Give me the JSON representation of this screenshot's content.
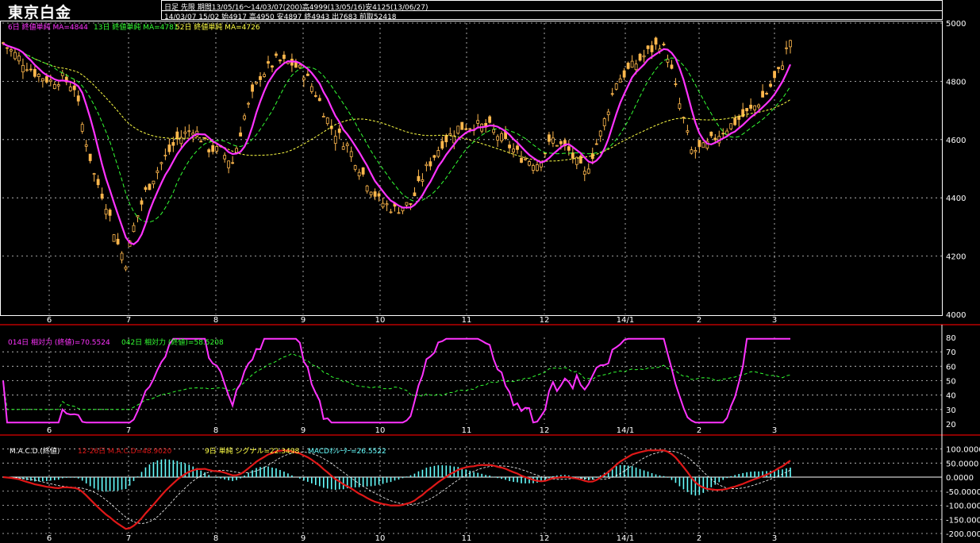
{
  "title": "東京白金",
  "info": {
    "line1": "日足 先限 期間13/05/16～14/03/07(200)高4999(13/05/16)安4125(13/06/27)",
    "line2": "14/03/07 15/02 始4917 高4950 安4897 終4943 出7683 前取52418"
  },
  "colors": {
    "background": "#000000",
    "candle": "#ffb84d",
    "ma6": "#ff33ff",
    "ma13": "#33ff33",
    "ma52": "#ffff44",
    "macd": "#e01818",
    "signal": "#ffffff",
    "histogram": "#66ffff",
    "separator": "#e00000",
    "grid": "#d0d0d0"
  },
  "price_panel": {
    "legend": [
      {
        "text": "6日 終値単純 MA=4844",
        "color": "#ff33ff"
      },
      {
        "text": "13日 終値単純 MA=4781",
        "color": "#33ff33"
      },
      {
        "text": "52日 終値単純 MA=4726",
        "color": "#ffff44"
      }
    ],
    "y_ticks": [
      "5000",
      "4800",
      "4600",
      "4400",
      "4200",
      "4000"
    ],
    "x_labels": [
      "6",
      "7",
      "8",
      "9",
      "10",
      "11",
      "12",
      "14/1",
      "2",
      "3"
    ]
  },
  "rsi_panel": {
    "legend": [
      {
        "text": "014日 相対力 (終値)=70.5524",
        "color": "#ff33ff"
      },
      {
        "text": "042日 相対力 (終値)=58.5208",
        "color": "#33ff33"
      }
    ],
    "y_ticks": [
      "80",
      "70",
      "60",
      "50",
      "40",
      "30",
      "20"
    ],
    "x_labels": [
      "6",
      "7",
      "8",
      "9",
      "10",
      "11",
      "12",
      "14/1",
      "2",
      "3"
    ]
  },
  "macd_panel": {
    "legend": [
      {
        "text": "M.A.C.D.(終値)",
        "color": "#ffffff"
      },
      {
        "text": "12-26日 M.A.C.D=48.9020",
        "color": "#e01818"
      },
      {
        "text": "9日 単純 シグナル=22.3498",
        "color": "#ffff44"
      },
      {
        "text": "MACDｵｼﾚｰﾀｰ=26.5522",
        "color": "#66ffff"
      }
    ],
    "y_ticks": [
      "100.0000",
      "50.0000",
      "0.0000",
      "-50.0000",
      "-100.0000",
      "-150.0000",
      "-200.0000"
    ],
    "x_labels": [
      "6",
      "7",
      "8",
      "9",
      "10",
      "11",
      "12",
      "14/1",
      "2",
      "3"
    ]
  },
  "chart_data": {
    "type": "line",
    "title": "東京白金",
    "y_range_price": [
      4000,
      5000
    ],
    "y_range_rsi": [
      20,
      80
    ],
    "y_range_macd": [
      -200,
      100
    ],
    "close_keypoints": [
      [
        0,
        4930
      ],
      [
        4,
        4880
      ],
      [
        8,
        4830
      ],
      [
        12,
        4800
      ],
      [
        15,
        4810
      ],
      [
        18,
        4780
      ],
      [
        20,
        4650
      ],
      [
        23,
        4480
      ],
      [
        26,
        4380
      ],
      [
        29,
        4240
      ],
      [
        31,
        4180
      ],
      [
        33,
        4300
      ],
      [
        36,
        4420
      ],
      [
        40,
        4520
      ],
      [
        44,
        4600
      ],
      [
        48,
        4640
      ],
      [
        52,
        4570
      ],
      [
        55,
        4560
      ],
      [
        58,
        4520
      ],
      [
        61,
        4680
      ],
      [
        65,
        4820
      ],
      [
        69,
        4870
      ],
      [
        73,
        4860
      ],
      [
        76,
        4830
      ],
      [
        79,
        4760
      ],
      [
        83,
        4640
      ],
      [
        87,
        4580
      ],
      [
        91,
        4480
      ],
      [
        95,
        4390
      ],
      [
        99,
        4360
      ],
      [
        103,
        4380
      ],
      [
        107,
        4500
      ],
      [
        111,
        4590
      ],
      [
        115,
        4640
      ],
      [
        119,
        4650
      ],
      [
        123,
        4640
      ],
      [
        127,
        4590
      ],
      [
        131,
        4540
      ],
      [
        135,
        4520
      ],
      [
        139,
        4600
      ],
      [
        143,
        4560
      ],
      [
        147,
        4480
      ],
      [
        151,
        4620
      ],
      [
        155,
        4800
      ],
      [
        159,
        4850
      ],
      [
        163,
        4900
      ],
      [
        166,
        4930
      ],
      [
        168,
        4890
      ],
      [
        171,
        4720
      ],
      [
        174,
        4560
      ],
      [
        177,
        4570
      ],
      [
        181,
        4620
      ],
      [
        185,
        4660
      ],
      [
        189,
        4700
      ],
      [
        193,
        4760
      ],
      [
        196,
        4830
      ],
      [
        199,
        4943
      ]
    ],
    "ma6_last": 4844,
    "ma13_last": 4781,
    "ma52_last": 4726,
    "rsi14_last": 70.5524,
    "rsi42_last": 58.5208,
    "macd_last": 48.902,
    "signal_last": 22.3498,
    "oscillator_last": 26.5522
  }
}
